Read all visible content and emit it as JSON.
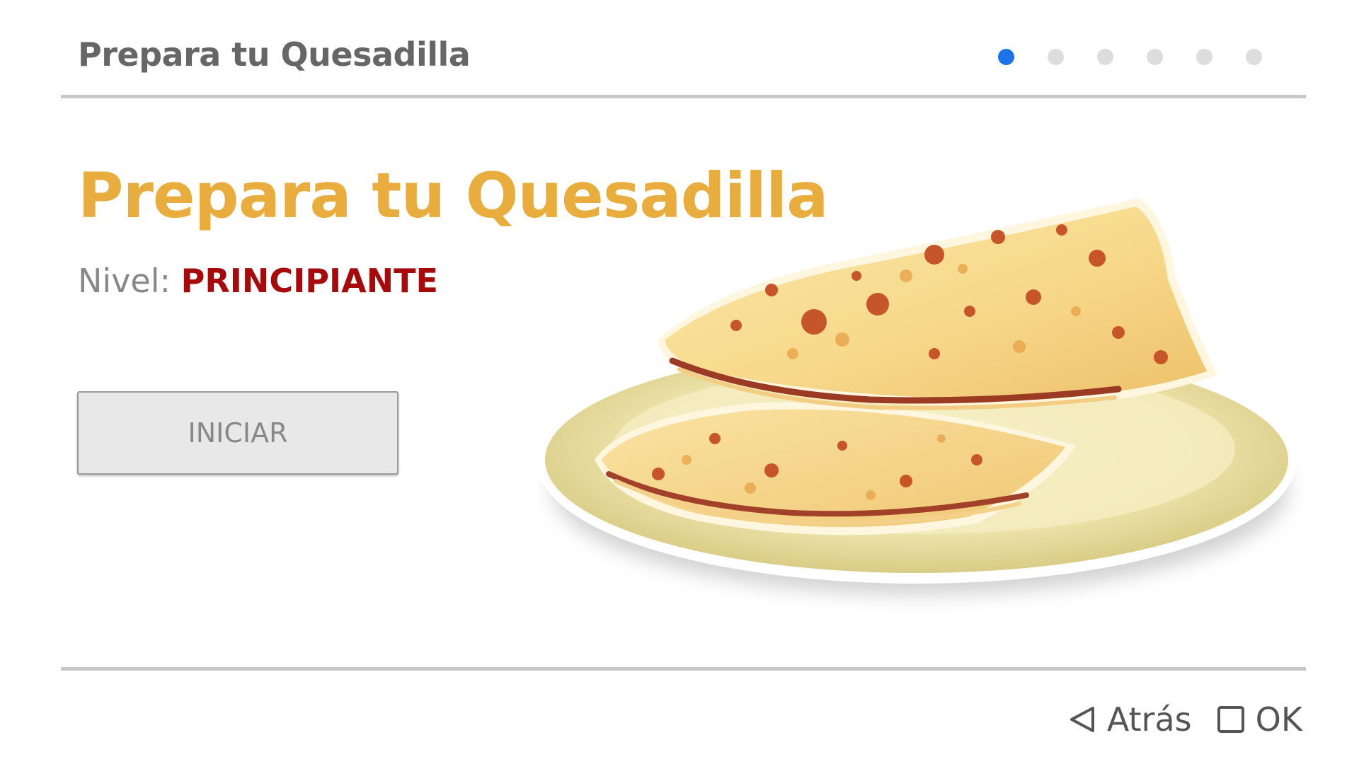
{
  "header": {
    "title": "Prepara tu Quesadilla",
    "progress": {
      "total_steps": 6,
      "current_step": 1
    }
  },
  "main": {
    "title": "Prepara tu Quesadilla",
    "level_label": "Nivel:",
    "level_value": "PRINCIPIANTE",
    "start_button_label": "INICIAR",
    "illustration": "quesadilla-on-plate"
  },
  "footer": {
    "back_label": "Atrás",
    "back_icon": "triangle-left-icon",
    "ok_label": "OK",
    "ok_icon": "square-icon"
  },
  "colors": {
    "title_accent": "#e8ad3c",
    "level_value": "#a60a0a",
    "active_dot": "#1a73e8",
    "inactive_dot": "#dddddd"
  }
}
